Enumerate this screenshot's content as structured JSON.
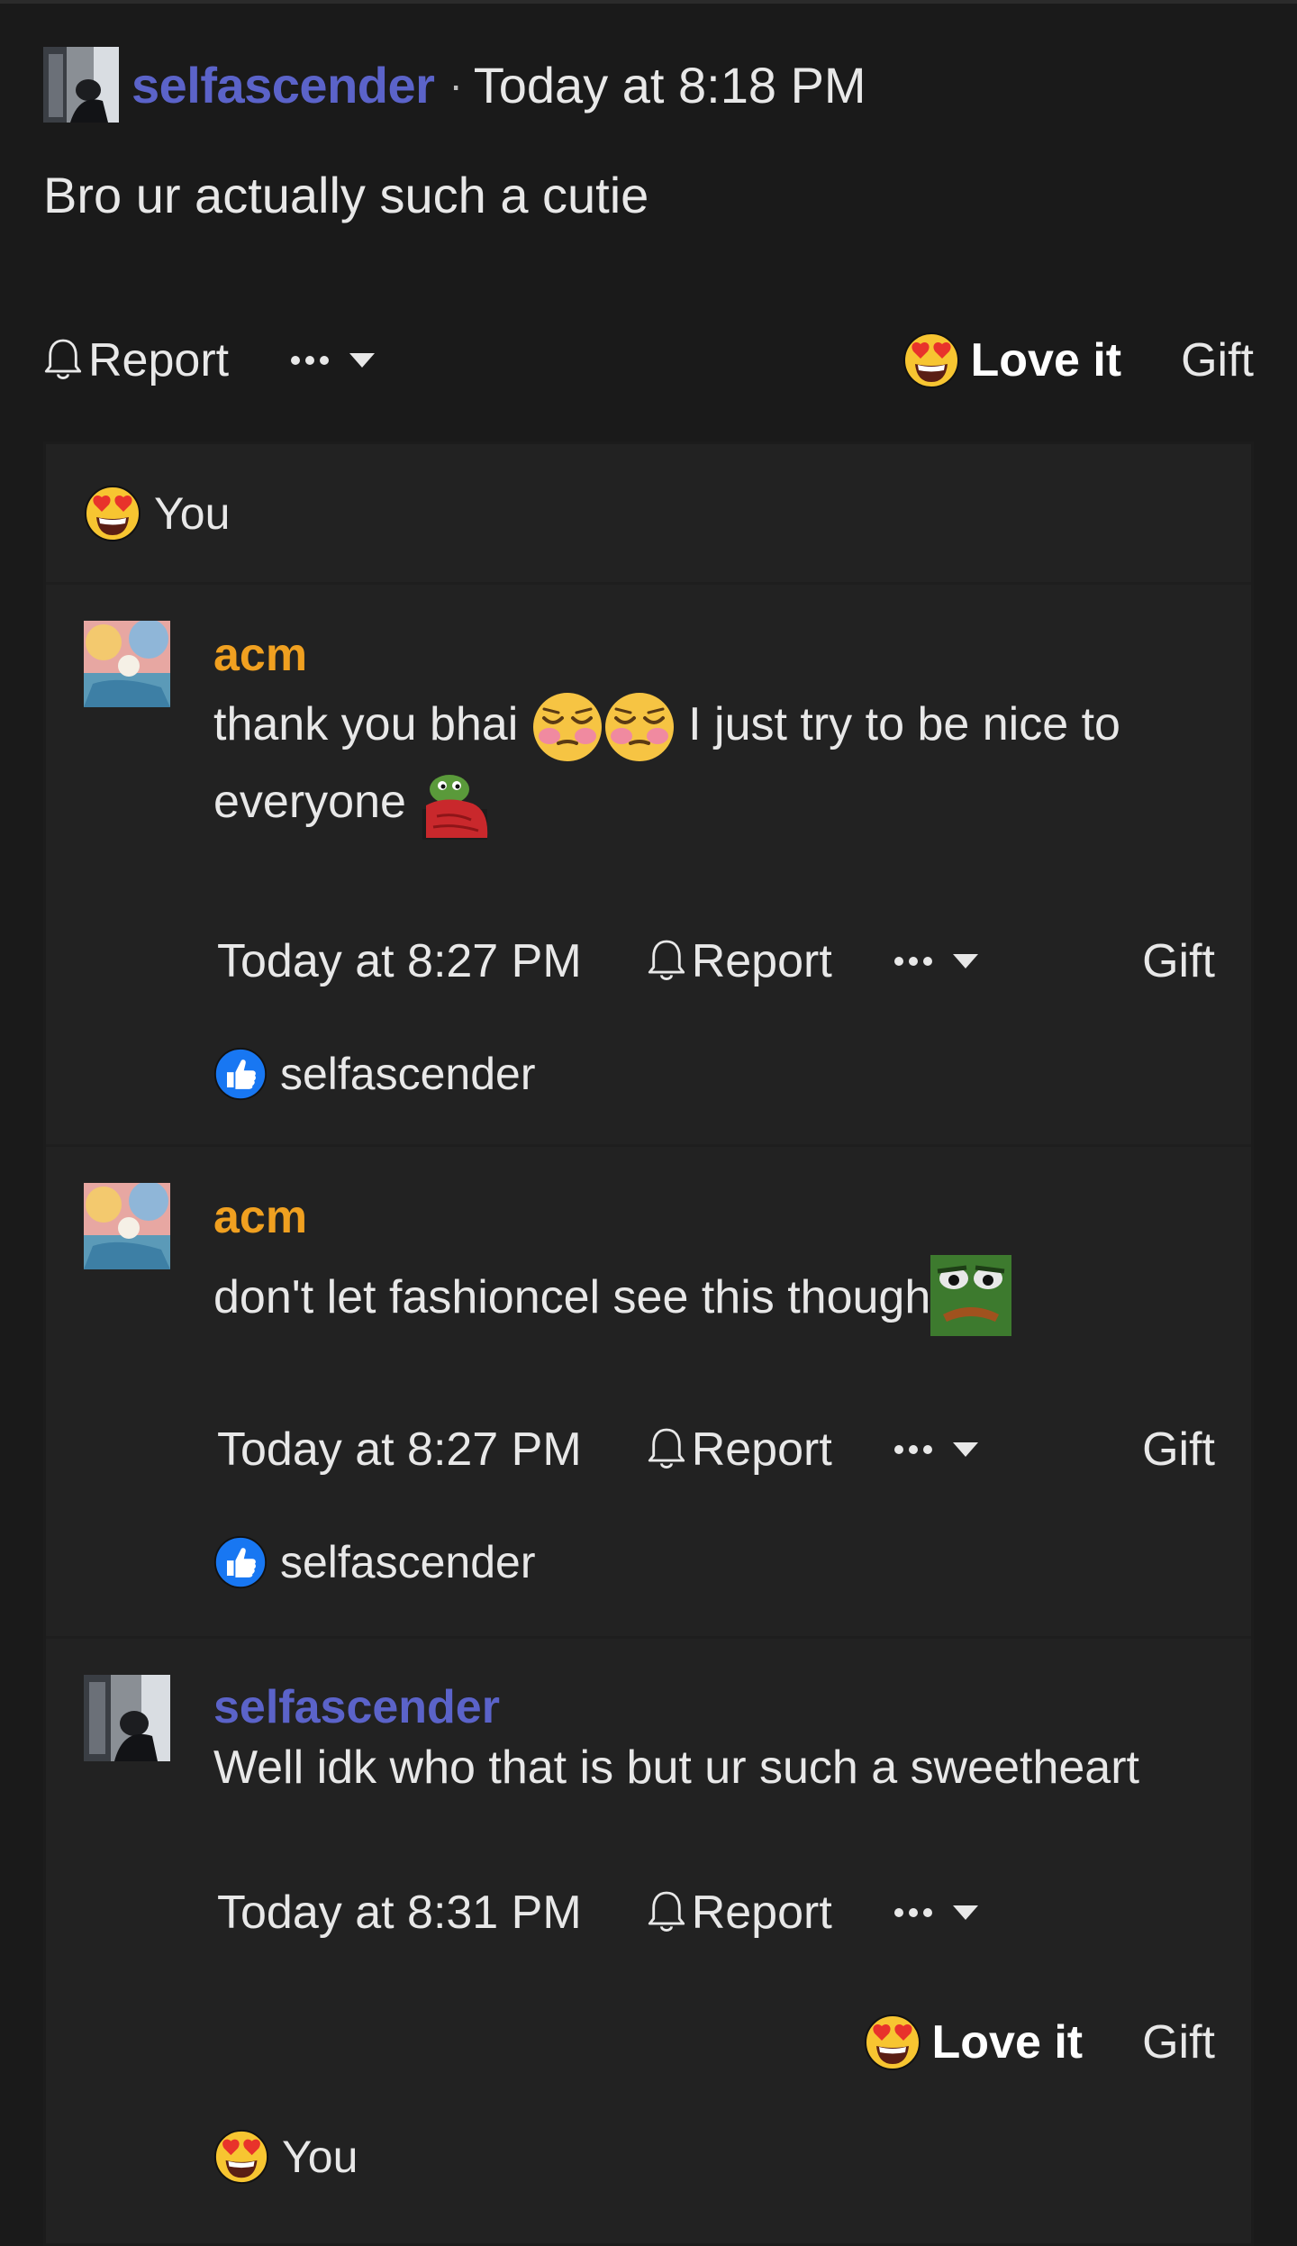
{
  "post": {
    "username": "selfascender",
    "separator": "·",
    "time": "Today at 8:18 PM",
    "body": "Bro ur actually such a cutie"
  },
  "actions": {
    "report": "Report",
    "love": "Love it",
    "gift": "Gift"
  },
  "post_reactions": {
    "user": "You",
    "icon": "heart-eyes-emoji"
  },
  "replies": [
    {
      "username": "acm",
      "name_color": "#f0a020",
      "text_part1": "thank you bhai ",
      "text_part2": " I just try to be nice to",
      "text_part3": "everyone ",
      "emojis": [
        "blush-emoji",
        "blush-emoji",
        "pepe-blanket-emoji"
      ],
      "time": "Today at 8:27 PM",
      "reaction": {
        "icon": "thumbs-up-icon",
        "user": "selfascender"
      }
    },
    {
      "username": "acm",
      "name_color": "#f0a020",
      "text": "don't let fashioncel see this though",
      "emojis": [
        "pepe-frown-emoji"
      ],
      "time": "Today at 8:27 PM",
      "reaction": {
        "icon": "thumbs-up-icon",
        "user": "selfascender"
      }
    },
    {
      "username": "selfascender",
      "name_color": "#5b63c9",
      "text": "Well idk who that is but ur such a sweetheart",
      "time": "Today at 8:31 PM",
      "love_label": "Love it",
      "reaction": {
        "icon": "heart-eyes-emoji",
        "user": "You"
      }
    }
  ],
  "colors": {
    "background": "#1a1a1a",
    "panel": "#222222",
    "username_blue": "#5b63c9",
    "username_orange": "#f0a020",
    "like_blue": "#1877f2"
  }
}
